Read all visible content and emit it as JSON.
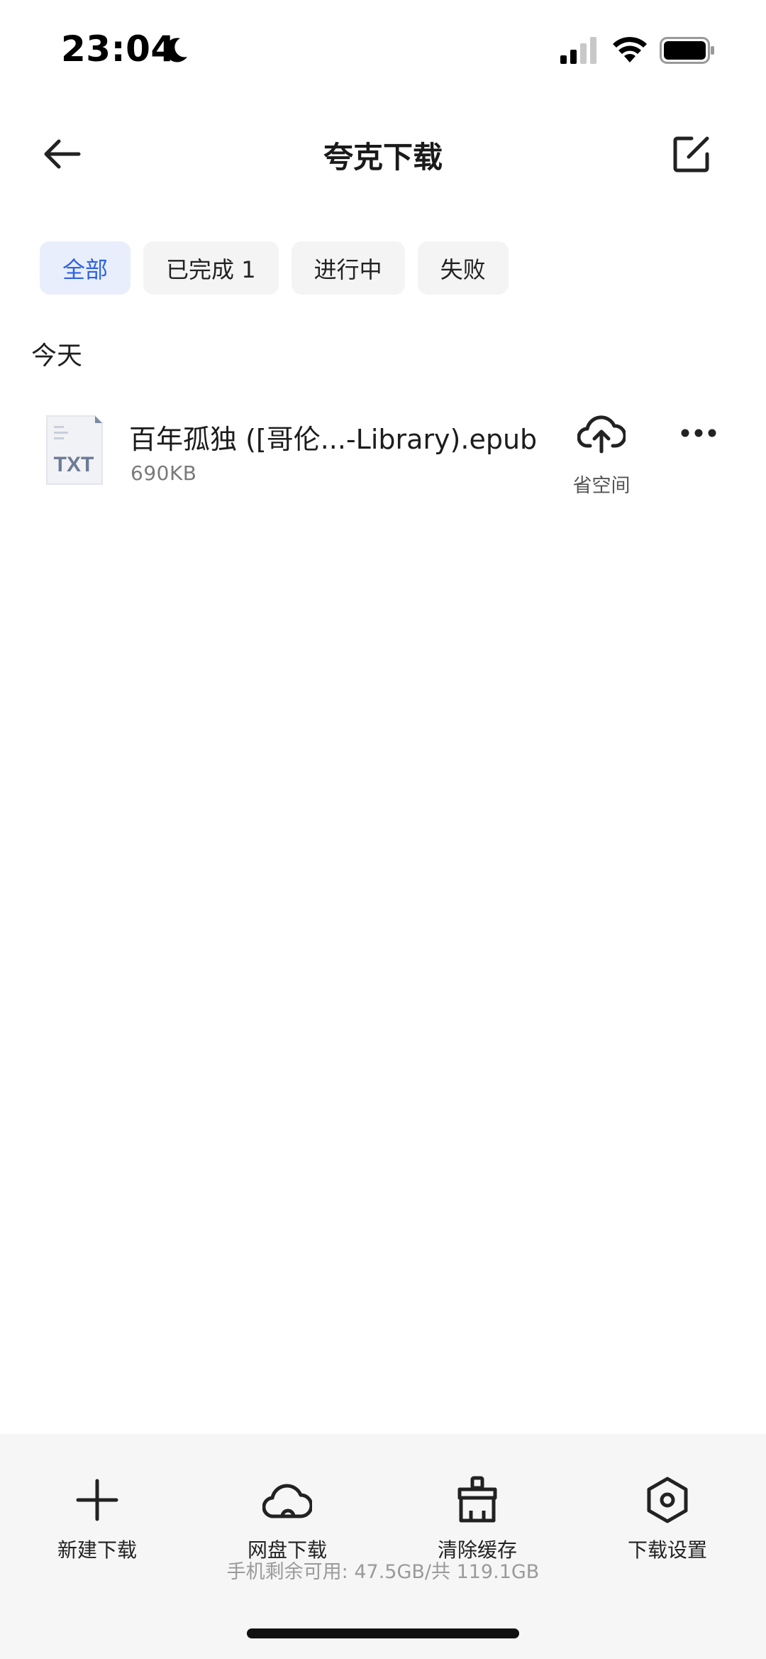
{
  "status_bar": {
    "time": "23:04"
  },
  "nav": {
    "title": "夸克下载"
  },
  "filters": [
    {
      "label": "全部",
      "active": true
    },
    {
      "label": "已完成 1",
      "active": false
    },
    {
      "label": "进行中",
      "active": false
    },
    {
      "label": "失败",
      "active": false
    }
  ],
  "section": {
    "label": "今天"
  },
  "item": {
    "file_type": "TXT",
    "name": "百年孤独 ([哥伦...-Library).epub",
    "size": "690KB",
    "save_space_label": "省空间"
  },
  "actions": [
    {
      "label": "新建下载",
      "icon": "plus-icon"
    },
    {
      "label": "网盘下载",
      "icon": "cloud-icon"
    },
    {
      "label": "清除缓存",
      "icon": "broom-icon"
    },
    {
      "label": "下载设置",
      "icon": "settings-hex-icon"
    }
  ],
  "storage": {
    "text": "手机剩余可用: 47.5GB/共 119.1GB"
  }
}
